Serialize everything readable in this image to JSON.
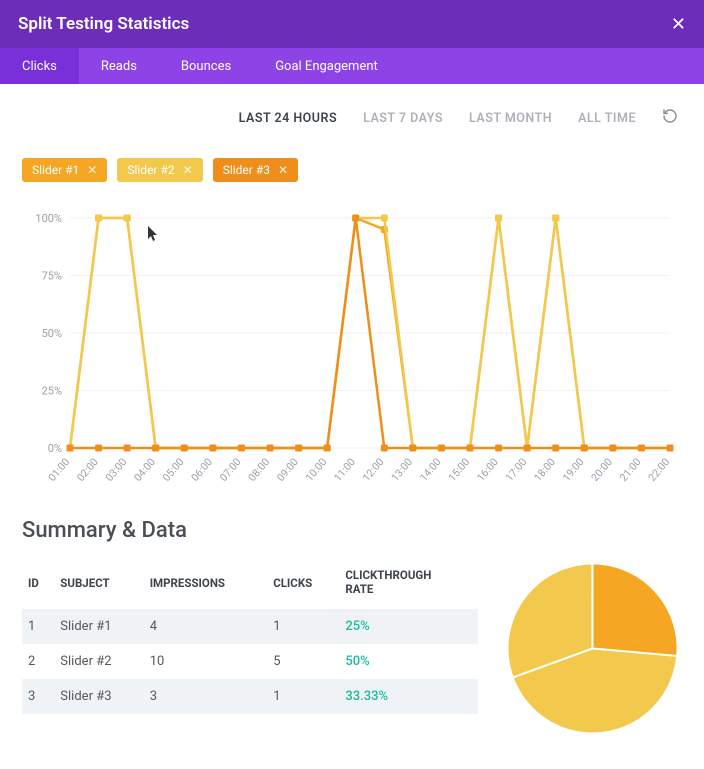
{
  "header": {
    "title": "Split Testing Statistics"
  },
  "tabs": [
    "Clicks",
    "Reads",
    "Bounces",
    "Goal Engagement"
  ],
  "activeTab": 0,
  "timeRanges": [
    "LAST 24 HOURS",
    "LAST 7 DAYS",
    "LAST MONTH",
    "ALL TIME"
  ],
  "activeTimeRange": 0,
  "sliders": [
    {
      "label": "Slider #1",
      "color": "#f5a623"
    },
    {
      "label": "Slider #2",
      "color": "#f2c94c"
    },
    {
      "label": "Slider #3",
      "color": "#ef8e1b"
    }
  ],
  "summaryTitle": "Summary & Data",
  "columns": [
    "ID",
    "SUBJECT",
    "IMPRESSIONS",
    "CLICKS",
    "CLICKTHROUGH RATE"
  ],
  "rows": [
    {
      "id": "1",
      "subject": "Slider #1",
      "impressions": "4",
      "clicks": "1",
      "rate": "25%"
    },
    {
      "id": "2",
      "subject": "Slider #2",
      "impressions": "10",
      "clicks": "5",
      "rate": "50%"
    },
    {
      "id": "3",
      "subject": "Slider #3",
      "impressions": "3",
      "clicks": "1",
      "rate": "33.33%"
    }
  ],
  "chart_data": {
    "type": "line",
    "title": "",
    "xlabel": "",
    "ylabel": "",
    "ylim": [
      0,
      100
    ],
    "y_ticks": [
      "0%",
      "25%",
      "50%",
      "75%",
      "100%"
    ],
    "categories": [
      "01:00",
      "02:00",
      "03:00",
      "04:00",
      "05:00",
      "06:00",
      "07:00",
      "08:00",
      "09:00",
      "10:00",
      "11:00",
      "12:00",
      "13:00",
      "14:00",
      "15:00",
      "16:00",
      "17:00",
      "18:00",
      "19:00",
      "20:00",
      "21:00",
      "22:00"
    ],
    "series": [
      {
        "name": "Slider #1",
        "color": "#f5a623",
        "values": [
          0,
          100,
          100,
          0,
          0,
          0,
          0,
          0,
          0,
          0,
          100,
          95,
          0,
          0,
          0,
          100,
          0,
          100,
          0,
          0,
          0,
          0
        ]
      },
      {
        "name": "Slider #2",
        "color": "#f2c94c",
        "values": [
          0,
          100,
          100,
          0,
          0,
          0,
          0,
          0,
          0,
          0,
          100,
          100,
          0,
          0,
          0,
          100,
          0,
          100,
          0,
          0,
          0,
          0
        ]
      },
      {
        "name": "Slider #3",
        "color": "#ef8e1b",
        "values": [
          0,
          0,
          0,
          0,
          0,
          0,
          0,
          0,
          0,
          0,
          100,
          0,
          0,
          0,
          0,
          0,
          0,
          0,
          0,
          0,
          0,
          0
        ]
      }
    ]
  },
  "pie_data": {
    "type": "pie",
    "slices": [
      {
        "name": "Slider #1",
        "value": 25,
        "color": "#f5a623"
      },
      {
        "name": "Slider #2",
        "value": 50,
        "color": "#f2c94c"
      },
      {
        "name": "Slider #3",
        "value": 33.33,
        "color": "#ef8e1b"
      }
    ]
  }
}
